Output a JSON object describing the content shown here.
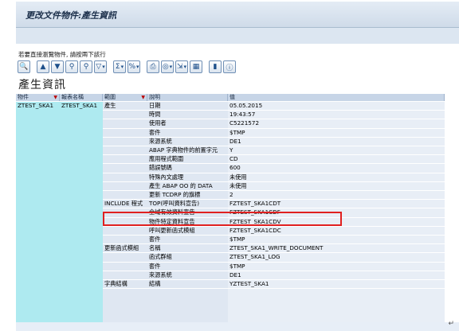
{
  "title": "更改文件物件:產生資訊",
  "hint": "若要直接瀏覽物件, 請按兩下該行",
  "heading": "產生資訊",
  "columns": [
    "物件",
    "報表名稱",
    "範圍",
    "說明",
    "值"
  ],
  "object": "ZTEST_SKA1",
  "report": "ZTEST_SKA1",
  "groups": [
    {
      "label": "產生",
      "row": 0
    },
    {
      "label": "INCLUDE 程式",
      "row": 15
    },
    {
      "label": "更新函式模組",
      "row": 20
    },
    {
      "label": "字典結構",
      "row": 25
    }
  ],
  "rows": [
    {
      "desc": "日期",
      "value": "05.05.2015"
    },
    {
      "desc": "時間",
      "value": "19:43:57"
    },
    {
      "desc": "使用者",
      "value": "C5221572"
    },
    {
      "desc": "套件",
      "value": "$TMP"
    },
    {
      "desc": "來源系統",
      "value": "DE1"
    },
    {
      "desc": "ABAP 字典物件的前置字元",
      "value": "Y"
    },
    {
      "desc": "應用程式範圍",
      "value": "CD"
    },
    {
      "desc": "錯誤號碼",
      "value": "600"
    },
    {
      "desc": "特殊內文處理",
      "value": "未使用"
    },
    {
      "desc": "產生 ABAP OO 的 DATA",
      "value": "未使用"
    },
    {
      "desc": "更新 TCDRP 的旗標",
      "value": "2"
    },
    {
      "desc": "TOP(呼叫資料宣告)",
      "value": "FZTEST_SKA1CDT"
    },
    {
      "desc": "全域有效資料宣告",
      "value": "FZTEST_SKA1CDF"
    },
    {
      "desc": "物件特定資料宣告",
      "value": "FZTEST_SKA1CDV"
    },
    {
      "desc": "呼叫更新函式模組",
      "value": "FZTEST_SKA1CDC"
    },
    {
      "desc": "套件",
      "value": "$TMP"
    },
    {
      "desc": "名稱",
      "value": "ZTEST_SKA1_WRITE_DOCUMENT"
    },
    {
      "desc": "函式群組",
      "value": "ZTEST_SKA1_LOG"
    },
    {
      "desc": "套件",
      "value": "$TMP"
    },
    {
      "desc": "來源系統",
      "value": "DE1"
    },
    {
      "desc": "結構",
      "value": "YZTEST_SKA1"
    }
  ],
  "colors": {
    "header": "#c7d5e7",
    "keycol": "#aeeaf0",
    "bodycol": "#dfe7f2",
    "highlight": "#e02020"
  }
}
